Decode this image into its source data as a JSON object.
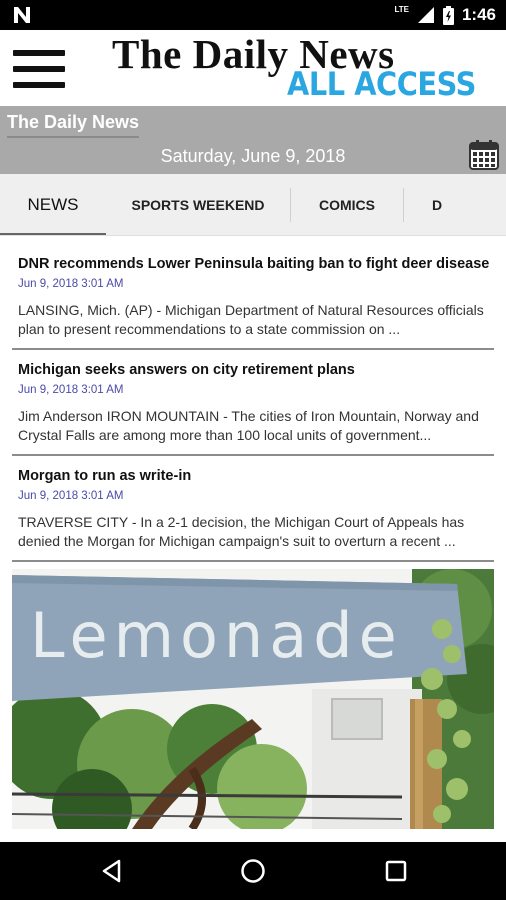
{
  "status_bar": {
    "time": "1:46",
    "network": "LTE"
  },
  "header": {
    "menu_icon": "hamburger-menu-icon",
    "title": "The Daily News",
    "subtitle": "ALL ACCESS",
    "accent_color": "#2aa7e0"
  },
  "section": {
    "name": "The Daily News",
    "date": "Saturday, June 9, 2018",
    "calendar_icon": "calendar-icon"
  },
  "tabs": [
    {
      "label": "NEWS",
      "active": true
    },
    {
      "label": "SPORTS WEEKEND",
      "active": false
    },
    {
      "label": "COMICS",
      "active": false
    },
    {
      "label": "D",
      "active": false
    }
  ],
  "articles": [
    {
      "headline": "DNR recommends Lower Peninsula baiting ban to fight deer disease",
      "date": "Jun 9, 2018 3:01 AM",
      "summary": "LANSING, Mich. (AP) - Michigan Department of Natural Resources officials plan to present recommendations to a state commission on ..."
    },
    {
      "headline": "Michigan seeks answers on city retirement plans",
      "date": "Jun 9, 2018 3:01 AM",
      "summary": "Jim Anderson IRON MOUNTAIN - The cities of Iron Mountain, Norway and Crystal Falls are among more than 100 local units of government..."
    },
    {
      "headline": "Morgan to run as write-in",
      "date": "Jun 9, 2018 3:01 AM",
      "summary": "TRAVERSE CITY - In a 2-1 decision, the Michigan Court of Appeals has denied the Morgan for Michigan campaign's suit to overturn a recent ..."
    }
  ],
  "photo": {
    "sign_text": "Lemonade"
  },
  "nav_bar": {
    "back_icon": "back-triangle-icon",
    "home_icon": "home-circle-icon",
    "recents_icon": "recents-square-icon"
  }
}
